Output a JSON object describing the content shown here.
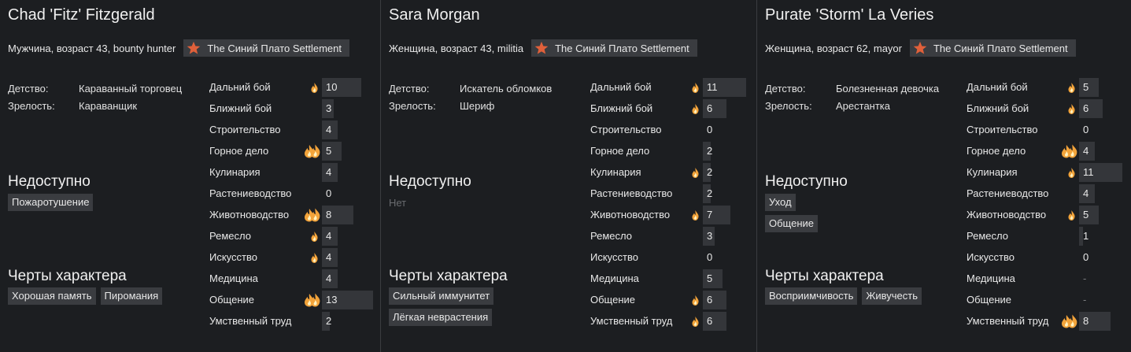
{
  "labels": {
    "childhood": "Детство:",
    "adulthood": "Зрелость:",
    "incapable": "Недоступно",
    "traits": "Черты характера",
    "none": "Нет"
  },
  "colors": {
    "background": "#1c1e21",
    "tag_bg": "#3a3c40",
    "skill_bar": "#34363a",
    "faction_star": "#e0603a",
    "flame": "#f2a33a"
  },
  "pawns": [
    {
      "name": "Chad 'Fitz' Fitzgerald",
      "info": "Мужчина, возраст 43, bounty hunter",
      "faction": "The Синий Плато Settlement",
      "childhood": "Караванный торговец",
      "adulthood": "Караванщик",
      "incapable": [
        "Пожаротушение"
      ],
      "traits": [
        [
          "Хорошая память",
          "Пиромания"
        ]
      ],
      "skills": [
        {
          "label": "Дальний бой",
          "value": "10",
          "passion": 1,
          "level": 10
        },
        {
          "label": "Ближний бой",
          "value": "3",
          "passion": 0,
          "level": 3
        },
        {
          "label": "Строительство",
          "value": "4",
          "passion": 0,
          "level": 4
        },
        {
          "label": "Горное дело",
          "value": "5",
          "passion": 2,
          "level": 5
        },
        {
          "label": "Кулинария",
          "value": "4",
          "passion": 0,
          "level": 4
        },
        {
          "label": "Растениеводство",
          "value": "0",
          "passion": 0,
          "level": 0
        },
        {
          "label": "Животноводство",
          "value": "8",
          "passion": 2,
          "level": 8
        },
        {
          "label": "Ремесло",
          "value": "4",
          "passion": 1,
          "level": 4
        },
        {
          "label": "Искусство",
          "value": "4",
          "passion": 1,
          "level": 4
        },
        {
          "label": "Медицина",
          "value": "4",
          "passion": 0,
          "level": 4
        },
        {
          "label": "Общение",
          "value": "13",
          "passion": 2,
          "level": 13
        },
        {
          "label": "Умственный труд",
          "value": "2",
          "passion": 0,
          "level": 2
        }
      ]
    },
    {
      "name": "Sara Morgan",
      "info": "Женщина, возраст 43, militia",
      "faction": "The Синий Плато Settlement",
      "childhood": "Искатель обломков",
      "adulthood": "Шериф",
      "incapable": [],
      "traits": [
        [
          "Сильный иммунитет"
        ],
        [
          "Лёгкая неврастения"
        ]
      ],
      "skills": [
        {
          "label": "Дальний бой",
          "value": "11",
          "passion": 1,
          "level": 11
        },
        {
          "label": "Ближний бой",
          "value": "6",
          "passion": 1,
          "level": 6
        },
        {
          "label": "Строительство",
          "value": "0",
          "passion": 0,
          "level": 0
        },
        {
          "label": "Горное дело",
          "value": "2",
          "passion": 0,
          "level": 2
        },
        {
          "label": "Кулинария",
          "value": "2",
          "passion": 1,
          "level": 2
        },
        {
          "label": "Растениеводство",
          "value": "2",
          "passion": 0,
          "level": 2
        },
        {
          "label": "Животноводство",
          "value": "7",
          "passion": 1,
          "level": 7
        },
        {
          "label": "Ремесло",
          "value": "3",
          "passion": 0,
          "level": 3
        },
        {
          "label": "Искусство",
          "value": "0",
          "passion": 0,
          "level": 0
        },
        {
          "label": "Медицина",
          "value": "5",
          "passion": 0,
          "level": 5
        },
        {
          "label": "Общение",
          "value": "6",
          "passion": 1,
          "level": 6
        },
        {
          "label": "Умственный труд",
          "value": "6",
          "passion": 1,
          "level": 6
        }
      ]
    },
    {
      "name": "Purate 'Storm' La Veries",
      "info": "Женщина, возраст 62, mayor",
      "faction": "The Синий Плато Settlement",
      "childhood": "Болезненная девочка",
      "adulthood": "Арестантка",
      "incapable": [
        "Уход",
        "Общение"
      ],
      "traits": [
        [
          "Восприимчивость",
          "Живучесть"
        ]
      ],
      "skills": [
        {
          "label": "Дальний бой",
          "value": "5",
          "passion": 1,
          "level": 5
        },
        {
          "label": "Ближний бой",
          "value": "6",
          "passion": 1,
          "level": 6
        },
        {
          "label": "Строительство",
          "value": "0",
          "passion": 0,
          "level": 0
        },
        {
          "label": "Горное дело",
          "value": "4",
          "passion": 2,
          "level": 4
        },
        {
          "label": "Кулинария",
          "value": "11",
          "passion": 1,
          "level": 11
        },
        {
          "label": "Растениеводство",
          "value": "4",
          "passion": 0,
          "level": 4
        },
        {
          "label": "Животноводство",
          "value": "5",
          "passion": 1,
          "level": 5
        },
        {
          "label": "Ремесло",
          "value": "1",
          "passion": 0,
          "level": 1
        },
        {
          "label": "Искусство",
          "value": "0",
          "passion": 0,
          "level": 0
        },
        {
          "label": "Медицина",
          "value": "-",
          "passion": 0,
          "level": 0
        },
        {
          "label": "Общение",
          "value": "-",
          "passion": 0,
          "level": 0
        },
        {
          "label": "Умственный труд",
          "value": "8",
          "passion": 2,
          "level": 8
        }
      ]
    }
  ]
}
